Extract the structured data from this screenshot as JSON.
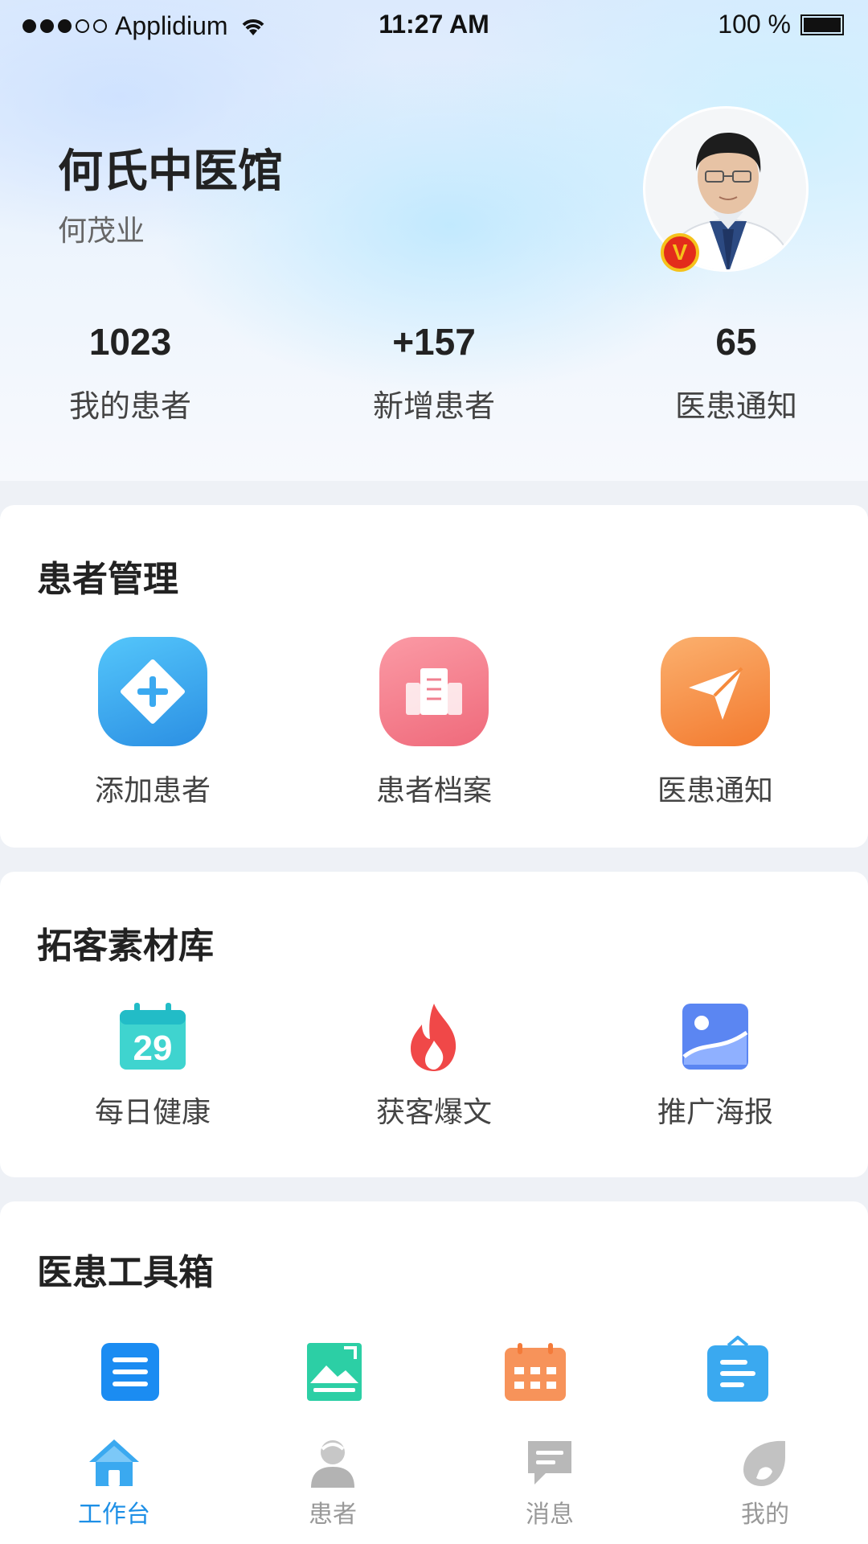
{
  "status_bar": {
    "carrier": "Applidium",
    "time": "11:27 AM",
    "battery": "100 %"
  },
  "header": {
    "clinic_name": "何氏中医馆",
    "doctor_name": "何茂业",
    "verified_badge": "V"
  },
  "stats": [
    {
      "value": "1023",
      "label": "我的患者"
    },
    {
      "value": "+157",
      "label": "新增患者"
    },
    {
      "value": "65",
      "label": "医患通知"
    }
  ],
  "patient_management": {
    "title": "患者管理",
    "items": [
      {
        "label": "添加患者",
        "icon": "add-patient-icon"
      },
      {
        "label": "患者档案",
        "icon": "patient-records-icon"
      },
      {
        "label": "医患通知",
        "icon": "notification-send-icon"
      }
    ]
  },
  "material_library": {
    "title": "拓客素材库",
    "items": [
      {
        "label": "每日健康",
        "icon": "calendar-29-icon",
        "calendar_day": "29"
      },
      {
        "label": "获客爆文",
        "icon": "flame-icon"
      },
      {
        "label": "推广海报",
        "icon": "poster-image-icon"
      }
    ]
  },
  "toolbox": {
    "title": "医患工具箱",
    "items": [
      {
        "icon": "document-list-icon"
      },
      {
        "icon": "image-card-icon"
      },
      {
        "icon": "schedule-calendar-icon"
      },
      {
        "icon": "clipboard-icon"
      }
    ]
  },
  "tabbar": {
    "items": [
      {
        "label": "工作台",
        "icon": "home-icon",
        "active": true
      },
      {
        "label": "患者",
        "icon": "patient-person-icon",
        "active": false
      },
      {
        "label": "消息",
        "icon": "message-icon",
        "active": false
      },
      {
        "label": "我的",
        "icon": "profile-icon",
        "active": false
      }
    ]
  },
  "colors": {
    "accent": "#1d8fe6",
    "add_patient": "#3aa9f0",
    "records": "#f26d7d",
    "notify": "#f58a3c"
  }
}
